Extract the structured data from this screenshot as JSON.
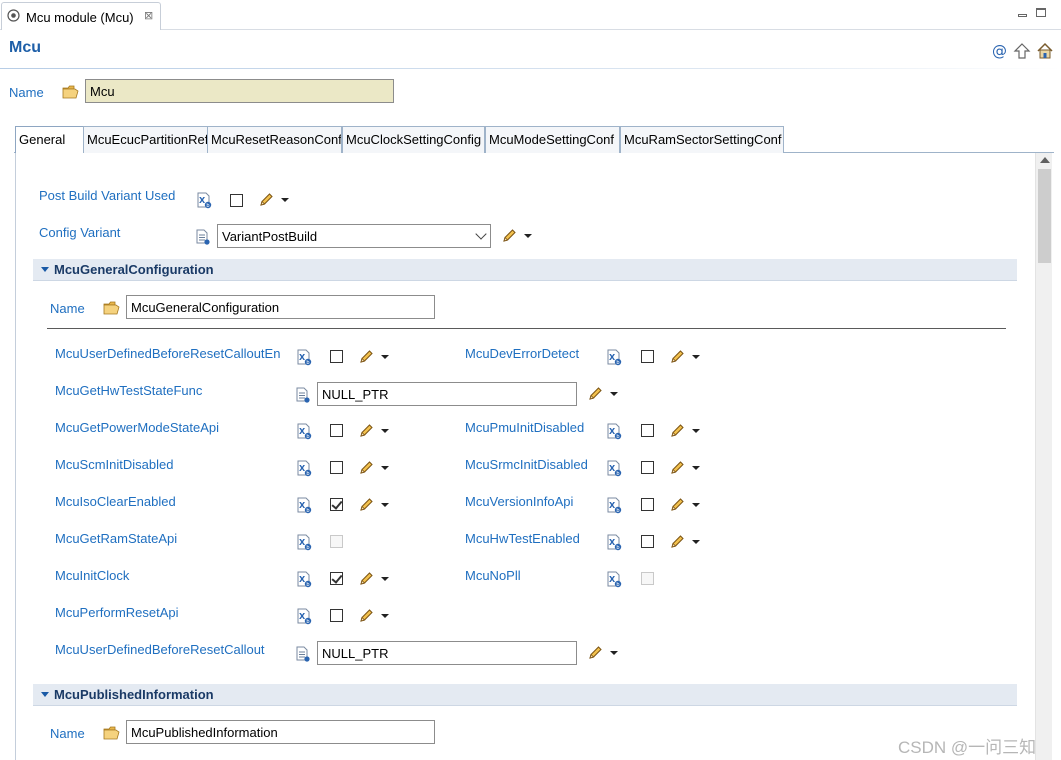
{
  "editor_tab": {
    "title": "Mcu module (Mcu)",
    "close_glyph": "⊠"
  },
  "header": {
    "title": "Mcu"
  },
  "module_name": {
    "label": "Name",
    "value": "Mcu"
  },
  "tabs": [
    {
      "label": "General"
    },
    {
      "label": "McuEcucPartitionRef"
    },
    {
      "label": "McuResetReasonConf"
    },
    {
      "label": "McuClockSettingConfig"
    },
    {
      "label": "McuModeSettingConf"
    },
    {
      "label": "McuRamSectorSettingConf"
    }
  ],
  "general": {
    "post_build_variant_used": {
      "label": "Post Build Variant Used",
      "checked": false
    },
    "config_variant": {
      "label": "Config Variant",
      "value": "VariantPostBuild"
    }
  },
  "sections": {
    "general_configuration": {
      "title": "McuGeneralConfiguration",
      "name_label": "Name",
      "name_value": "McuGeneralConfiguration",
      "params": [
        {
          "label": "McuUserDefinedBeforeResetCalloutEn",
          "checked": false
        },
        {
          "label": "McuDevErrorDetect",
          "checked": false
        },
        {
          "label": "McuGetHwTestStateFunc",
          "value": "NULL_PTR"
        },
        {
          "label": "McuGetPowerModeStateApi",
          "checked": false
        },
        {
          "label": "McuPmuInitDisabled",
          "checked": false
        },
        {
          "label": "McuScmInitDisabled",
          "checked": false
        },
        {
          "label": "McuSrmcInitDisabled",
          "checked": false
        },
        {
          "label": "McuIsoClearEnabled",
          "checked": true
        },
        {
          "label": "McuVersionInfoApi",
          "checked": false
        },
        {
          "label": "McuGetRamStateApi",
          "checked": false,
          "disabled": true
        },
        {
          "label": "McuHwTestEnabled",
          "checked": false
        },
        {
          "label": "McuInitClock",
          "checked": true
        },
        {
          "label": "McuNoPll",
          "checked": false,
          "disabled": true
        },
        {
          "label": "McuPerformResetApi",
          "checked": false
        },
        {
          "label": "McuUserDefinedBeforeResetCallout",
          "value": "NULL_PTR"
        }
      ]
    },
    "published_information": {
      "title": "McuPublishedInformation",
      "name_label": "Name",
      "name_value": "McuPublishedInformation"
    }
  },
  "watermark": "CSDN @一问三知",
  "icons": {
    "editor": "module-editor-icon",
    "at": "at-sign-icon",
    "up": "up-arrow-icon",
    "home": "home-icon",
    "folder": "folder-open-icon",
    "xdoc": "variant-doc-icon",
    "doc": "document-icon",
    "pencil": "edit-pencil-icon"
  },
  "colors": {
    "link": "#1f6fc0",
    "title": "#1e5fa8",
    "section_bg": "#e4eaf2",
    "name_field_bg": "#ebe8c6"
  }
}
